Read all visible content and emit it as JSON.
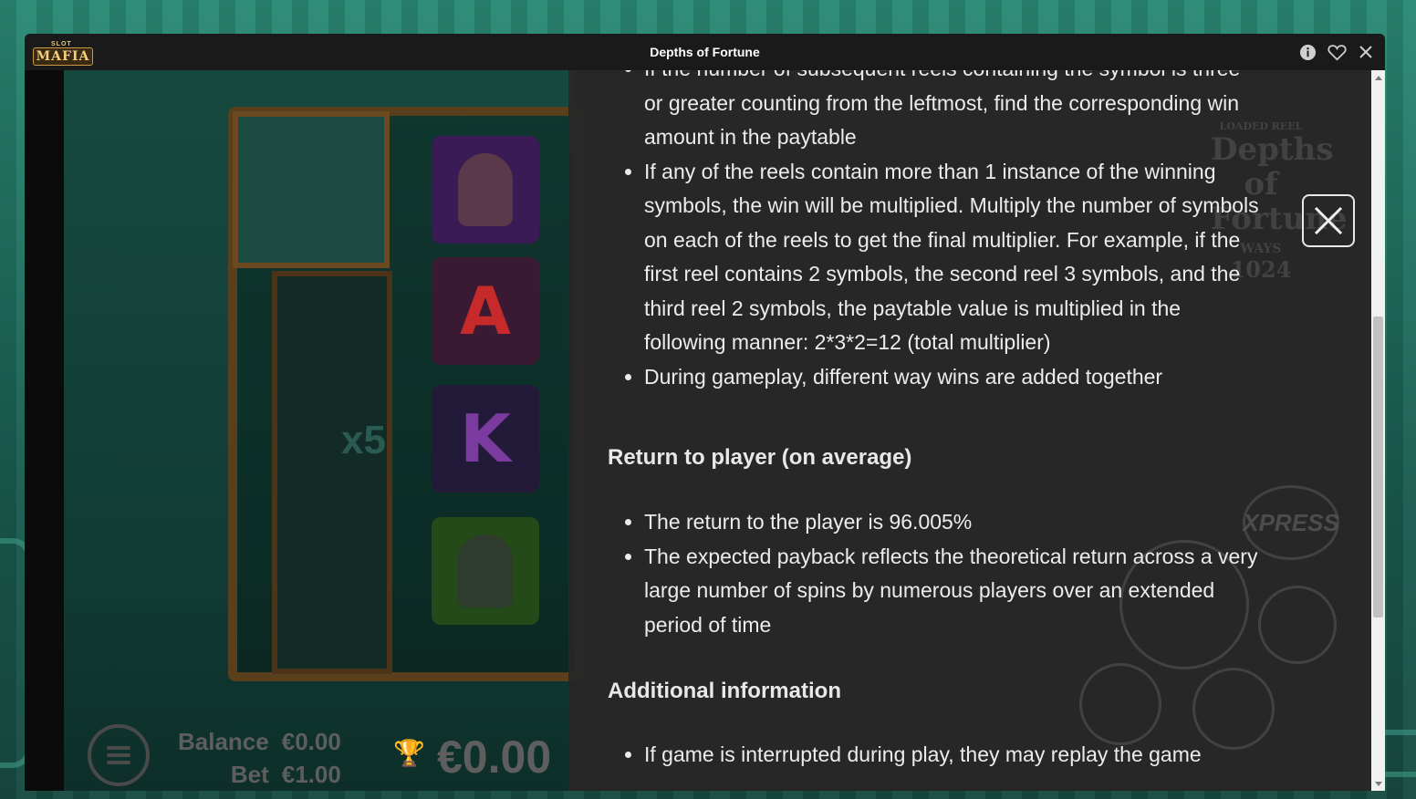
{
  "window": {
    "title": "Depths of Fortune",
    "logo_top": "SLOT",
    "logo_main": "MAFIA"
  },
  "titlebar_icons": [
    "info-icon",
    "heart-icon",
    "close-icon"
  ],
  "game": {
    "multiplier_label": "x5",
    "symbols": [
      "",
      "A",
      "K",
      ""
    ],
    "balance_label": "Balance",
    "balance_value": "€0.00",
    "bet_label": "Bet",
    "bet_value": "€1.00",
    "win_value": "€0.00",
    "ghost_logo": {
      "top": "LOADED REEL",
      "main": "Depths of Fortune",
      "ways_label": "WAYS",
      "ways_value": "1024"
    },
    "xpress_label": "XPRESS"
  },
  "info": {
    "ways_bullets": [
      "If the number of subsequent reels containing the symbol is three or greater counting from the leftmost, find the corresponding win amount in the paytable",
      "If any of the reels contain more than 1 instance of the winning symbols, the win will be multiplied. Multiply the number of symbols on each of the reels to get the final multiplier. For example, if the first reel contains 2 symbols, the second reel 3 symbols, and the third reel 2 symbols, the paytable value is multiplied in the following manner: 2*3*2=12 (total multiplier)",
      "During gameplay, different way wins are added together"
    ],
    "rtp_heading": "Return to player (on average)",
    "rtp_bullets": [
      "The return to the player is 96.005%",
      "The expected payback reflects the theoretical return across a very large number of spins by numerous players over an extended period of time"
    ],
    "additional_heading": "Additional information",
    "additional_bullets": [
      "If game is interrupted during play, they may replay the game"
    ]
  },
  "scrollbar": {
    "position": 0.55
  }
}
